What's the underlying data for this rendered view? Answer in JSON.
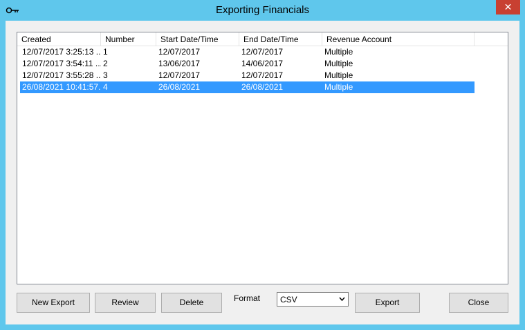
{
  "window": {
    "title": "Exporting Financials",
    "close_glyph": "✕",
    "icon": "key-icon"
  },
  "table": {
    "columns": [
      "Created",
      "Number",
      "Start Date/Time",
      "End Date/Time",
      "Revenue Account"
    ],
    "rows": [
      [
        "12/07/2017 3:25:13 ...",
        "1",
        "12/07/2017",
        "12/07/2017",
        "Multiple"
      ],
      [
        "12/07/2017 3:54:11 ...",
        "2",
        "13/06/2017",
        "14/06/2017",
        "Multiple"
      ],
      [
        "12/07/2017 3:55:28 ...",
        "3",
        "12/07/2017",
        "12/07/2017",
        "Multiple"
      ],
      [
        "26/08/2021 10:41:57...",
        "4",
        "26/08/2021",
        "26/08/2021",
        "Multiple"
      ]
    ],
    "selected_row": 3
  },
  "buttons": {
    "new_export": "New Export",
    "review": "Review",
    "delete": "Delete",
    "export": "Export",
    "close": "Close"
  },
  "format": {
    "label": "Format",
    "value": "CSV"
  },
  "colors": {
    "title_bar": "#5fc7ec",
    "close_button": "#c84031",
    "selection": "#3399ff"
  }
}
